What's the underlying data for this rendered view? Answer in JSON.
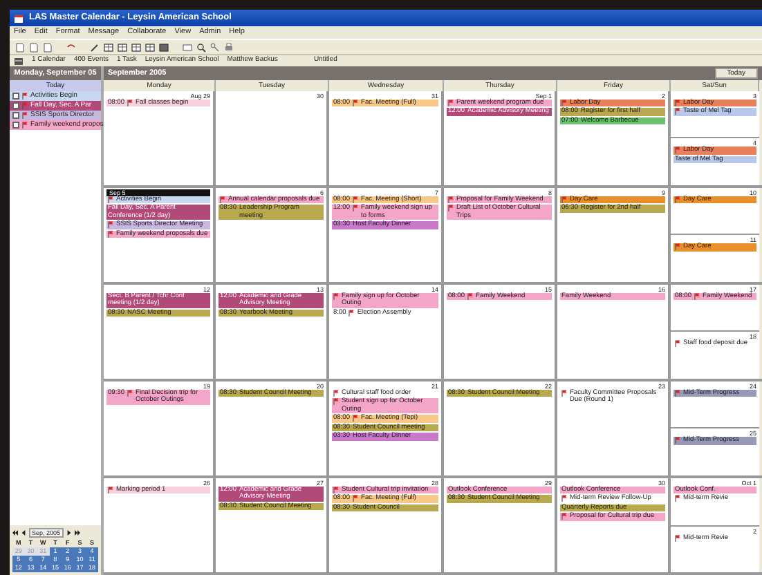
{
  "window": {
    "title": "LAS Master Calendar - Leysin American School"
  },
  "menu": [
    "File",
    "Edit",
    "Format",
    "Message",
    "Collaborate",
    "View",
    "Admin",
    "Help"
  ],
  "info_bar": [
    "1 Calendar",
    "400 Events",
    "1 Task",
    "Leysin American School",
    "Matthew Backus",
    "Untitled"
  ],
  "sidebar": {
    "header": "Monday, September 05",
    "subheader": "Today",
    "items": [
      {
        "text": "Activities Begin",
        "color": "#c8d8f0",
        "checked": false
      },
      {
        "text": "Fall Day, Sec. A Par",
        "color": "#b04a78",
        "checked": false
      },
      {
        "text": "SSIS Sports Director",
        "color": "#c8b8e0",
        "checked": false
      },
      {
        "text": "Family weekend propos",
        "color": "#f4a6c8",
        "checked": false
      }
    ],
    "mini_calendar": {
      "month": "Sep, 2005",
      "weekdays": [
        "M",
        "T",
        "W",
        "T",
        "F",
        "S",
        "S"
      ],
      "weeks": [
        [
          {
            "d": "29",
            "muted": true
          },
          {
            "d": "30",
            "muted": true
          },
          {
            "d": "31",
            "muted": true
          },
          {
            "d": "1",
            "muted": false
          },
          {
            "d": "2",
            "muted": false
          },
          {
            "d": "3",
            "muted": false
          },
          {
            "d": "4",
            "muted": false
          }
        ],
        [
          {
            "d": "5",
            "muted": false
          },
          {
            "d": "6",
            "muted": false
          },
          {
            "d": "7",
            "muted": false
          },
          {
            "d": "8",
            "muted": false
          },
          {
            "d": "9",
            "muted": false
          },
          {
            "d": "10",
            "muted": false
          },
          {
            "d": "11",
            "muted": false
          }
        ],
        [
          {
            "d": "12",
            "muted": false
          },
          {
            "d": "13",
            "muted": false
          },
          {
            "d": "14",
            "muted": false
          },
          {
            "d": "15",
            "muted": false
          },
          {
            "d": "16",
            "muted": false
          },
          {
            "d": "17",
            "muted": false
          },
          {
            "d": "18",
            "muted": false
          }
        ]
      ]
    }
  },
  "calendar": {
    "title": "September 2005",
    "today_button": "Today",
    "columns": [
      "Monday",
      "Tuesday",
      "Wednesday",
      "Thursday",
      "Friday",
      "Sat/Sun"
    ],
    "weeks": [
      [
        {
          "label": "Aug 29",
          "selected": false,
          "events": [
            {
              "time": "08:00",
              "text": "Fall classes begin",
              "color": "#f8d0e0",
              "flag": true
            }
          ]
        },
        {
          "label": "30",
          "selected": false
        },
        {
          "label": "31",
          "selected": false,
          "events": [
            {
              "time": "08:00",
              "text": "Fac. Meeting (Full)",
              "color": "#f8c888",
              "flag": true
            }
          ]
        },
        {
          "label": "Sep 1",
          "selected": false,
          "events": [
            {
              "text": "Parent weekend program due",
              "color": "#f4a6c8",
              "flag": true
            },
            {
              "time": "12:00",
              "text": "Academic Advisory Meeting",
              "color": "#b04a78",
              "flag": false
            }
          ]
        },
        {
          "label": "2",
          "selected": false,
          "events": [
            {
              "text": "Labor Day",
              "color": "#e8805c",
              "flag": true
            },
            {
              "time": "08:00",
              "text": "Register for first half",
              "color": "#b8a850",
              "flag": false
            },
            {
              "time": "07:00",
              "text": "Welcome Barbecue",
              "color": "#6cc070",
              "flag": false
            }
          ]
        },
        {
          "label": "3",
          "selected": false,
          "events": [
            {
              "text": "Labor Day",
              "color": "#e8805c",
              "flag": true
            },
            {
              "text": "Taste of Mel Tag",
              "color": "#b8c8e8",
              "flag": true
            }
          ]
        },
        {
          "label": "4",
          "selected": false,
          "events": [
            {
              "text": "Labor Day",
              "color": "#e8805c",
              "flag": true
            },
            {
              "text": "Taste of Mel Tag",
              "color": "#b8c8e8",
              "flag": false
            }
          ]
        }
      ],
      [
        {
          "label": "Sep 5",
          "selected": true,
          "events": [
            {
              "text": "Activities Begin",
              "color": "#c8d8f0",
              "flag": true
            },
            {
              "text": "Fall Day, Sec. A Parent Conference (1/2 day)",
              "color": "#b04a78",
              "flag": false
            },
            {
              "text": "SSIS Sports Director Meeting",
              "color": "#c8b8e0",
              "flag": true
            },
            {
              "text": "Family weekend proposals due",
              "color": "#f4a6c8",
              "flag": true
            }
          ]
        },
        {
          "label": "6",
          "selected": false,
          "events": [
            {
              "text": "Annual calendar proposals due",
              "color": "#f4a6c8",
              "flag": true
            },
            {
              "time": "08:30",
              "text": "Leadership Program meeting",
              "color": "#b8a850",
              "flag": false
            }
          ]
        },
        {
          "label": "7",
          "selected": false,
          "events": [
            {
              "time": "08:00",
              "text": "Fac. Meeting (Short)",
              "color": "#f8c888",
              "flag": true
            },
            {
              "time": "12:00",
              "text": "Family weekend sign up to forms",
              "color": "#f4a6c8",
              "flag": true
            },
            {
              "time": "03:30",
              "text": "Host Faculty Dinner",
              "color": "#c87ac8",
              "flag": false
            }
          ]
        },
        {
          "label": "8",
          "selected": false,
          "events": [
            {
              "text": "Proposal for Family Weekend",
              "color": "#f4a6c8",
              "flag": true
            },
            {
              "text": "Draft List of October Cultural Trips",
              "color": "#f4a6c8",
              "flag": true
            }
          ]
        },
        {
          "label": "9",
          "selected": false,
          "events": [
            {
              "text": "Day Care",
              "color": "#e8902c",
              "flag": true
            },
            {
              "time": "06:30",
              "text": "Register for 2nd half",
              "color": "#b8a850",
              "flag": false
            }
          ]
        },
        {
          "label": "10",
          "selected": false,
          "events": [
            {
              "text": "Day Care",
              "color": "#e8902c",
              "flag": true
            }
          ]
        },
        {
          "label": "11",
          "selected": false,
          "events": [
            {
              "text": "Day Care",
              "color": "#e8902c",
              "flag": true
            }
          ]
        }
      ],
      [
        {
          "label": "12",
          "selected": false,
          "events": [
            {
              "text": "Sect. B Parent / Tchr Conf meeting (1/2 day)",
              "color": "#b04a78",
              "flag": false
            },
            {
              "time": "08:30",
              "text": "NASC Meeting",
              "color": "#b8a850",
              "flag": false
            }
          ]
        },
        {
          "label": "13",
          "selected": false,
          "events": [
            {
              "time": "12:00",
              "text": "Academic and Grade Advisory Meeting",
              "color": "#b04a78",
              "flag": false
            },
            {
              "time": "08:30",
              "text": "Yearbook Meeting",
              "color": "#b8a850",
              "flag": false
            }
          ]
        },
        {
          "label": "14",
          "selected": false,
          "events": [
            {
              "text": "Family sign up for October Outing",
              "color": "#f4a6c8",
              "flag": true
            },
            {
              "time": "8:00",
              "text": "Election Assembly",
              "color": "#ffffff",
              "flag": true
            }
          ]
        },
        {
          "label": "15",
          "selected": false,
          "events": [
            {
              "time": "08:00",
              "text": "Family Weekend",
              "color": "#f4a6c8",
              "flag": true
            }
          ]
        },
        {
          "label": "16",
          "selected": false,
          "events": [
            {
              "text": "Family Weekend",
              "color": "#f4a6c8",
              "flag": false
            }
          ]
        },
        {
          "label": "17",
          "selected": false,
          "events": [
            {
              "time": "08:00",
              "text": "Family Weekend",
              "color": "#f4a6c8",
              "flag": true
            }
          ]
        },
        {
          "label": "18",
          "selected": false,
          "events": [
            {
              "text": "Staff food deposit due",
              "color": "#ffffff",
              "flag": true
            }
          ]
        }
      ],
      [
        {
          "label": "19",
          "selected": false,
          "events": [
            {
              "time": "09:30",
              "text": "Final Decision trip for October Outings",
              "color": "#f4a6c8",
              "flag": true
            }
          ]
        },
        {
          "label": "20",
          "selected": false,
          "events": [
            {
              "time": "08:30",
              "text": "Student Council Meeting",
              "color": "#b8a850",
              "flag": false
            }
          ]
        },
        {
          "label": "21",
          "selected": false,
          "events": [
            {
              "text": "Cultural staff food order",
              "color": "#ffffff",
              "flag": true
            },
            {
              "text": "Student sign up for October Outing",
              "color": "#f4a6c8",
              "flag": true
            },
            {
              "time": "08:00",
              "text": "Fac. Meeting (Tepi)",
              "color": "#f8c888",
              "flag": true
            },
            {
              "time": "08:30",
              "text": "Student Council meeting",
              "color": "#b8a850",
              "flag": false
            },
            {
              "time": "03:30",
              "text": "Host Faculty Dinner",
              "color": "#c87ac8",
              "flag": false
            }
          ]
        },
        {
          "label": "22",
          "selected": false,
          "events": [
            {
              "time": "08:30",
              "text": "Student Council Meeting",
              "color": "#b8a850",
              "flag": false
            }
          ]
        },
        {
          "label": "23",
          "selected": false,
          "events": [
            {
              "text": "Faculty Committee Proposals Due (Round 1)",
              "color": "#ffffff",
              "flag": true
            }
          ]
        },
        {
          "label": "24",
          "selected": false,
          "events": [
            {
              "text": "Mid-Term Progress",
              "color": "#9898b8",
              "flag": true
            }
          ]
        },
        {
          "label": "25",
          "selected": false,
          "events": [
            {
              "text": "Mid-Term Progress",
              "color": "#9898b8",
              "flag": true
            }
          ]
        }
      ],
      [
        {
          "label": "26",
          "selected": false,
          "events": [
            {
              "text": "Marking period 1",
              "color": "#f8d0e0",
              "flag": true
            }
          ]
        },
        {
          "label": "27",
          "selected": false,
          "events": [
            {
              "time": "12:00",
              "text": "Academic and Grade Advisory Meeting",
              "color": "#b04a78",
              "flag": false
            },
            {
              "time": "08:30",
              "text": "Student Council Meeting",
              "color": "#b8a850",
              "flag": false
            }
          ]
        },
        {
          "label": "28",
          "selected": false,
          "events": [
            {
              "text": "Student Cultural trip invitation",
              "color": "#f4a6c8",
              "flag": true
            },
            {
              "time": "08:00",
              "text": "Fac. Meeting (Full)",
              "color": "#f8c888",
              "flag": true
            },
            {
              "time": "08:30",
              "text": "Student Council",
              "color": "#b8a850",
              "flag": false
            }
          ]
        },
        {
          "label": "29",
          "selected": false,
          "events": [
            {
              "text": "Outlook Conference",
              "color": "#f4a6c8",
              "flag": false
            },
            {
              "time": "08:30",
              "text": "Student Council Meeting",
              "color": "#b8a850",
              "flag": false
            }
          ]
        },
        {
          "label": "30",
          "selected": false,
          "events": [
            {
              "text": "Outlook Conference",
              "color": "#f4a6c8",
              "flag": false
            },
            {
              "text": "Mid-term Review Follow-Up",
              "color": "#ffffff",
              "flag": true
            },
            {
              "text": "Quarterly Reports due",
              "color": "#b8a850",
              "flag": false
            },
            {
              "text": "Proposal for Cultural trip due",
              "color": "#f4a6c8",
              "flag": true
            }
          ]
        },
        {
          "label": "Oct 1",
          "selected": false,
          "events": [
            {
              "text": "Outlook Conf.",
              "color": "#f4a6c8",
              "flag": false
            },
            {
              "text": "Mid-term Revie",
              "color": "#ffffff",
              "flag": true
            }
          ]
        },
        {
          "label": "2",
          "selected": false,
          "events": [
            {
              "text": "Mid-term Revie",
              "color": "#ffffff",
              "flag": true
            }
          ]
        }
      ]
    ]
  }
}
